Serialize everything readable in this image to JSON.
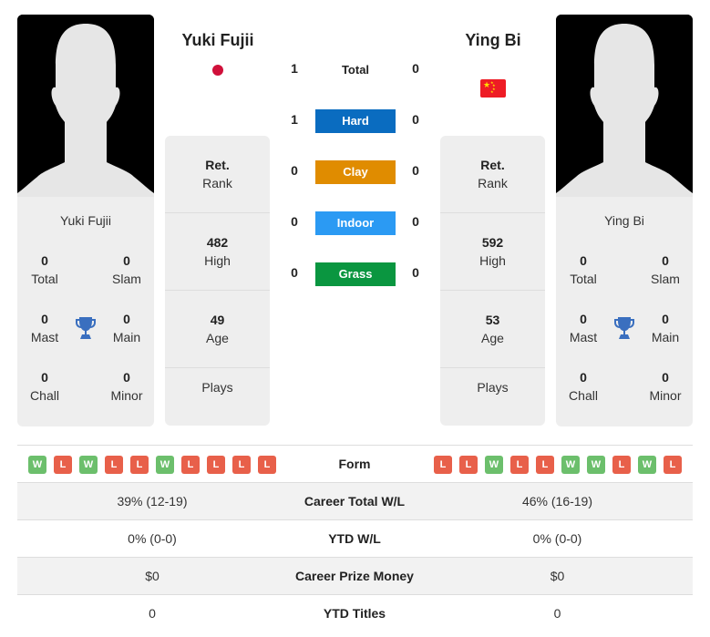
{
  "player1": {
    "name": "Yuki Fujii",
    "flag": "japan-flag",
    "titles": {
      "total": {
        "value": "0",
        "label": "Total"
      },
      "slam": {
        "value": "0",
        "label": "Slam"
      },
      "mast": {
        "value": "0",
        "label": "Mast"
      },
      "main": {
        "value": "0",
        "label": "Main"
      },
      "chall": {
        "value": "0",
        "label": "Chall"
      },
      "minor": {
        "value": "0",
        "label": "Minor"
      }
    },
    "rank": {
      "value": "Ret.",
      "label": "Rank"
    },
    "high": {
      "value": "482",
      "label": "High"
    },
    "age": {
      "value": "49",
      "label": "Age"
    },
    "plays": {
      "value": "",
      "label": "Plays"
    },
    "form": [
      "W",
      "L",
      "W",
      "L",
      "L",
      "W",
      "L",
      "L",
      "L",
      "L"
    ],
    "career_wl": "39% (12-19)",
    "ytd_wl": "0% (0-0)",
    "prize_money": "$0",
    "ytd_titles": "0"
  },
  "player2": {
    "name": "Ying Bi",
    "flag": "china-flag",
    "titles": {
      "total": {
        "value": "0",
        "label": "Total"
      },
      "slam": {
        "value": "0",
        "label": "Slam"
      },
      "mast": {
        "value": "0",
        "label": "Mast"
      },
      "main": {
        "value": "0",
        "label": "Main"
      },
      "chall": {
        "value": "0",
        "label": "Chall"
      },
      "minor": {
        "value": "0",
        "label": "Minor"
      }
    },
    "rank": {
      "value": "Ret.",
      "label": "Rank"
    },
    "high": {
      "value": "592",
      "label": "High"
    },
    "age": {
      "value": "53",
      "label": "Age"
    },
    "plays": {
      "value": "",
      "label": "Plays"
    },
    "form": [
      "L",
      "L",
      "W",
      "L",
      "L",
      "W",
      "W",
      "L",
      "W",
      "L"
    ],
    "career_wl": "46% (16-19)",
    "ytd_wl": "0% (0-0)",
    "prize_money": "$0",
    "ytd_titles": "0"
  },
  "h2h": {
    "total": {
      "label": "Total",
      "p1": "1",
      "p2": "0"
    },
    "surfaces": [
      {
        "label": "Hard",
        "p1": "1",
        "p2": "0",
        "color": "#0a6cc0"
      },
      {
        "label": "Clay",
        "p1": "0",
        "p2": "0",
        "color": "#e08c00"
      },
      {
        "label": "Indoor",
        "p1": "0",
        "p2": "0",
        "color": "#2b9af3"
      },
      {
        "label": "Grass",
        "p1": "0",
        "p2": "0",
        "color": "#0a9640"
      }
    ]
  },
  "rows": {
    "form": "Form",
    "career_wl": "Career Total W/L",
    "ytd_wl": "YTD W/L",
    "prize_money": "Career Prize Money",
    "ytd_titles": "YTD Titles"
  }
}
